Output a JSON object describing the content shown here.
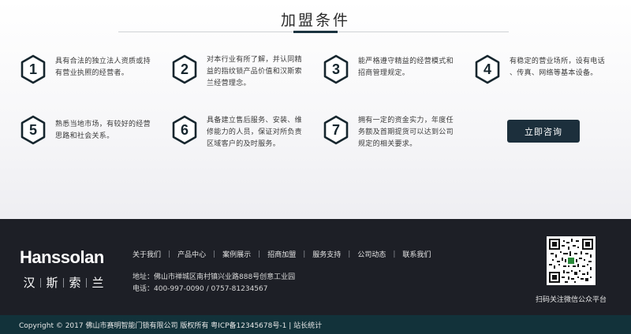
{
  "section": {
    "title": "加盟条件"
  },
  "conditions": [
    {
      "num": "1",
      "lines": [
        "具有合法的独立法人资质或持",
        "有营业执照的经营者。"
      ]
    },
    {
      "num": "2",
      "lines": [
        "对本行业有所了解，并认同精",
        "益的指纹锁产品价值和汉斯索",
        "兰经营理念。"
      ]
    },
    {
      "num": "3",
      "lines": [
        "能严格遵守精益的经营模式和",
        "招商管理规定。"
      ]
    },
    {
      "num": "4",
      "lines": [
        "有稳定的营业场所，设有电话",
        "、传真、网络等基本设备。"
      ]
    },
    {
      "num": "5",
      "lines": [
        "熟悉当地市场，有较好的经营",
        "思路和社会关系。"
      ]
    },
    {
      "num": "6",
      "lines": [
        "具备建立售后服务、安装、维",
        "修能力的人员，保证对所负责",
        "区域客户的及时服务。"
      ]
    },
    {
      "num": "7",
      "lines": [
        "拥有一定的资金实力，年度任",
        "务额及首期提货可以达到公司",
        "规定的相关要求。"
      ]
    }
  ],
  "consult_button": "立即咨询",
  "footer": {
    "logo_en": "Hanssolan",
    "logo_cn": [
      "汉",
      "斯",
      "索",
      "兰"
    ],
    "nav": [
      "关于我们",
      "产品中心",
      "案例展示",
      "招商加盟",
      "服务支持",
      "公司动态",
      "联系我们"
    ],
    "address": "地址：佛山市禅城区南村镇兴业路888号创意工业园",
    "phone": "电话：400-997-0090 / 0757-81234567",
    "qr_caption": "扫码关注微信公众平台",
    "qr_icon": "qr-code-icon"
  },
  "copyright": "Copyright © 2017 佛山市赛明智能门锁有限公司 版权所有 粤ICP备12345678号-1 | 站长统计",
  "colors": {
    "accent": "#1b3440",
    "footer_bg": "#1d1f26",
    "copyright_bg": "#12323a",
    "button_bg": "#1c2f3c"
  }
}
